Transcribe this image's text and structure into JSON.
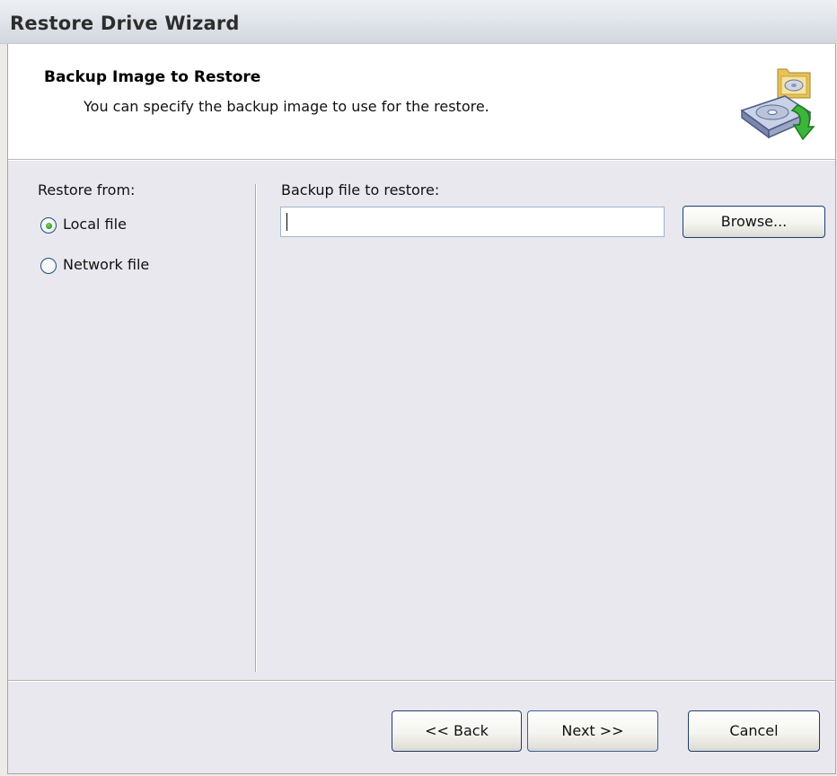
{
  "window": {
    "title": "Restore Drive Wizard"
  },
  "header": {
    "title": "Backup Image to Restore",
    "subtitle": "You can specify the backup image to use for the restore.",
    "icon": "restore-drive-icon"
  },
  "restore_from": {
    "label": "Restore from:",
    "options": [
      {
        "label": "Local file",
        "selected": true
      },
      {
        "label": "Network file",
        "selected": false
      }
    ]
  },
  "backup_file": {
    "label": "Backup file to restore:",
    "value": "",
    "browse_label": "Browse..."
  },
  "footer": {
    "back_label": "<< Back",
    "next_label": "Next >>",
    "cancel_label": "Cancel"
  },
  "colors": {
    "accent_border": "#1e3f6f",
    "radio_selected": "#2f9a1c",
    "panel_background": "#e9e8ef"
  }
}
